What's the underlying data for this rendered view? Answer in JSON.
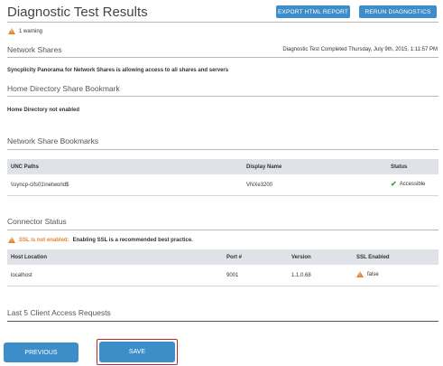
{
  "header": {
    "title": "Diagnostic Test Results",
    "export_label": "EXPORT HTML REPORT",
    "rerun_label": "RERUN DIAGNOSTICS"
  },
  "warning_summary": "1 warning",
  "network_shares": {
    "title": "Network Shares",
    "completed_text": "Diagnostic Test Completed Thursday, July 9th, 2015, 1:11:57 PM",
    "message": "Syncplicity Panorama for Network Shares is allowing access to all shares and servers"
  },
  "home_directory": {
    "title": "Home Directory Share Bookmark",
    "message": "Home Directory not enabled"
  },
  "bookmarks": {
    "title": "Network Share Bookmarks",
    "columns": [
      "UNC Paths",
      "Display Name",
      "Status"
    ],
    "rows": [
      {
        "unc": "\\\\syncp-cifs01\\networld$",
        "display": "VNXe3200",
        "status": "Accessible"
      }
    ]
  },
  "connector": {
    "title": "Connector Status",
    "warn_prefix": "SSL is not enabled:",
    "warn_text": "Enabling SSL is a recommended best practice.",
    "columns": [
      "Host Location",
      "Port #",
      "Version",
      "SSL Enabled"
    ],
    "rows": [
      {
        "host": "localhost",
        "port": "9001",
        "version": "1.1.0.68",
        "ssl": "false"
      }
    ]
  },
  "client_access": {
    "title": "Last 5 Client Access Requests"
  },
  "footer": {
    "previous_label": "PREVIOUS",
    "save_label": "SAVE"
  },
  "colors": {
    "accent": "#3d8dc9",
    "warning": "#e8842a",
    "success": "#3aa14a",
    "save_outline": "#c0262f"
  }
}
